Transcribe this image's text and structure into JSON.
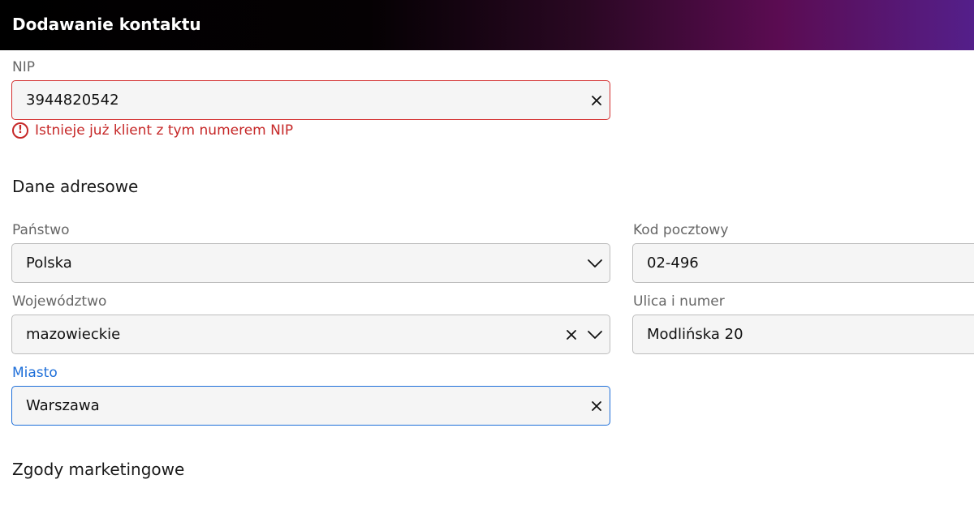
{
  "header": {
    "title": "Dodawanie kontaktu"
  },
  "nip": {
    "label": "NIP",
    "value": "3944820542",
    "error": "Istnieje już klient z tym numerem NIP",
    "error_icon": "!"
  },
  "address_section": {
    "title": "Dane adresowe"
  },
  "country": {
    "label": "Państwo",
    "value": "Polska"
  },
  "postal_code": {
    "label": "Kod pocztowy",
    "value": "02-496"
  },
  "voivodeship": {
    "label": "Województwo",
    "value": "mazowieckie"
  },
  "street": {
    "label": "Ulica i numer",
    "value": "Modlińska 20"
  },
  "city": {
    "label": "Miasto",
    "value": "Warszawa"
  },
  "marketing_section": {
    "title": "Zgody marketingowe"
  },
  "colors": {
    "error": "#c62828",
    "focus": "#1e6fd9",
    "header_start": "#000000",
    "header_end": "#541f8a"
  }
}
